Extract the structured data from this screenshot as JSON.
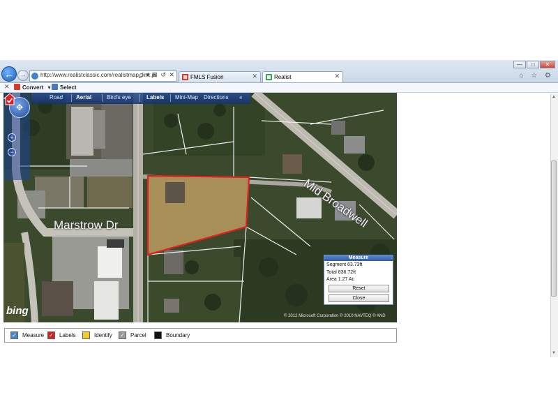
{
  "browser": {
    "url": "http://www.realistclassic.com/realistmap_link.js",
    "address_controls": "ρ ▾ ⊠ ↺ ✕",
    "tabs": [
      {
        "label": "FMLS Fusion",
        "active": false
      },
      {
        "label": "Realist",
        "active": true
      }
    ],
    "window_controls": {
      "minimize": "—",
      "maximize": "□",
      "close": "✕"
    },
    "chrome_icons": "⌂ ☆ ⚙",
    "back_glyph": "←",
    "forward_glyph": "→",
    "tab_close_glyph": "✕",
    "command_bar": {
      "close": "✕",
      "convert": "Convert",
      "convert_caret": "▾",
      "select": "Select"
    }
  },
  "map": {
    "toolbar": [
      {
        "label": "Road",
        "selected": false
      },
      {
        "label": "Aerial",
        "selected": true
      },
      {
        "label": "Bird's eye",
        "selected": false
      },
      {
        "label": "Labels",
        "selected": true
      },
      {
        "label": "Mini-Map",
        "selected": false
      },
      {
        "label": "Directions",
        "selected": false
      }
    ],
    "collapse_glyph": "«",
    "pan_glyph": "✥",
    "zoom_in_glyph": "+",
    "zoom_out_glyph": "−",
    "street_labels": {
      "marstrow": "Marstrow Dr",
      "midbroad": "Mid Broadwell"
    },
    "logo": "bing",
    "copyright": "© 2012 Microsoft Corporation  © 2010 NAVTEQ  © AND",
    "parcel_highlight_color": "#e02020"
  },
  "measure": {
    "title": "Measure",
    "segment": "Segment 63.73ft",
    "total": "Total 836.72ft",
    "area": "Area 1.27 Ac",
    "reset": "Reset",
    "close": "Close"
  },
  "legend": [
    {
      "label": "Measure",
      "color": "#4a86c5",
      "mark": "✓"
    },
    {
      "label": "Labels",
      "color": "#d32020",
      "mark": "✓"
    },
    {
      "label": "Identify",
      "color": "#f2cc2a",
      "mark": ""
    },
    {
      "label": "Parcel",
      "color": "#9a9a9a",
      "mark": "✓"
    },
    {
      "label": "Boundary",
      "color": "#111111",
      "mark": ""
    }
  ]
}
